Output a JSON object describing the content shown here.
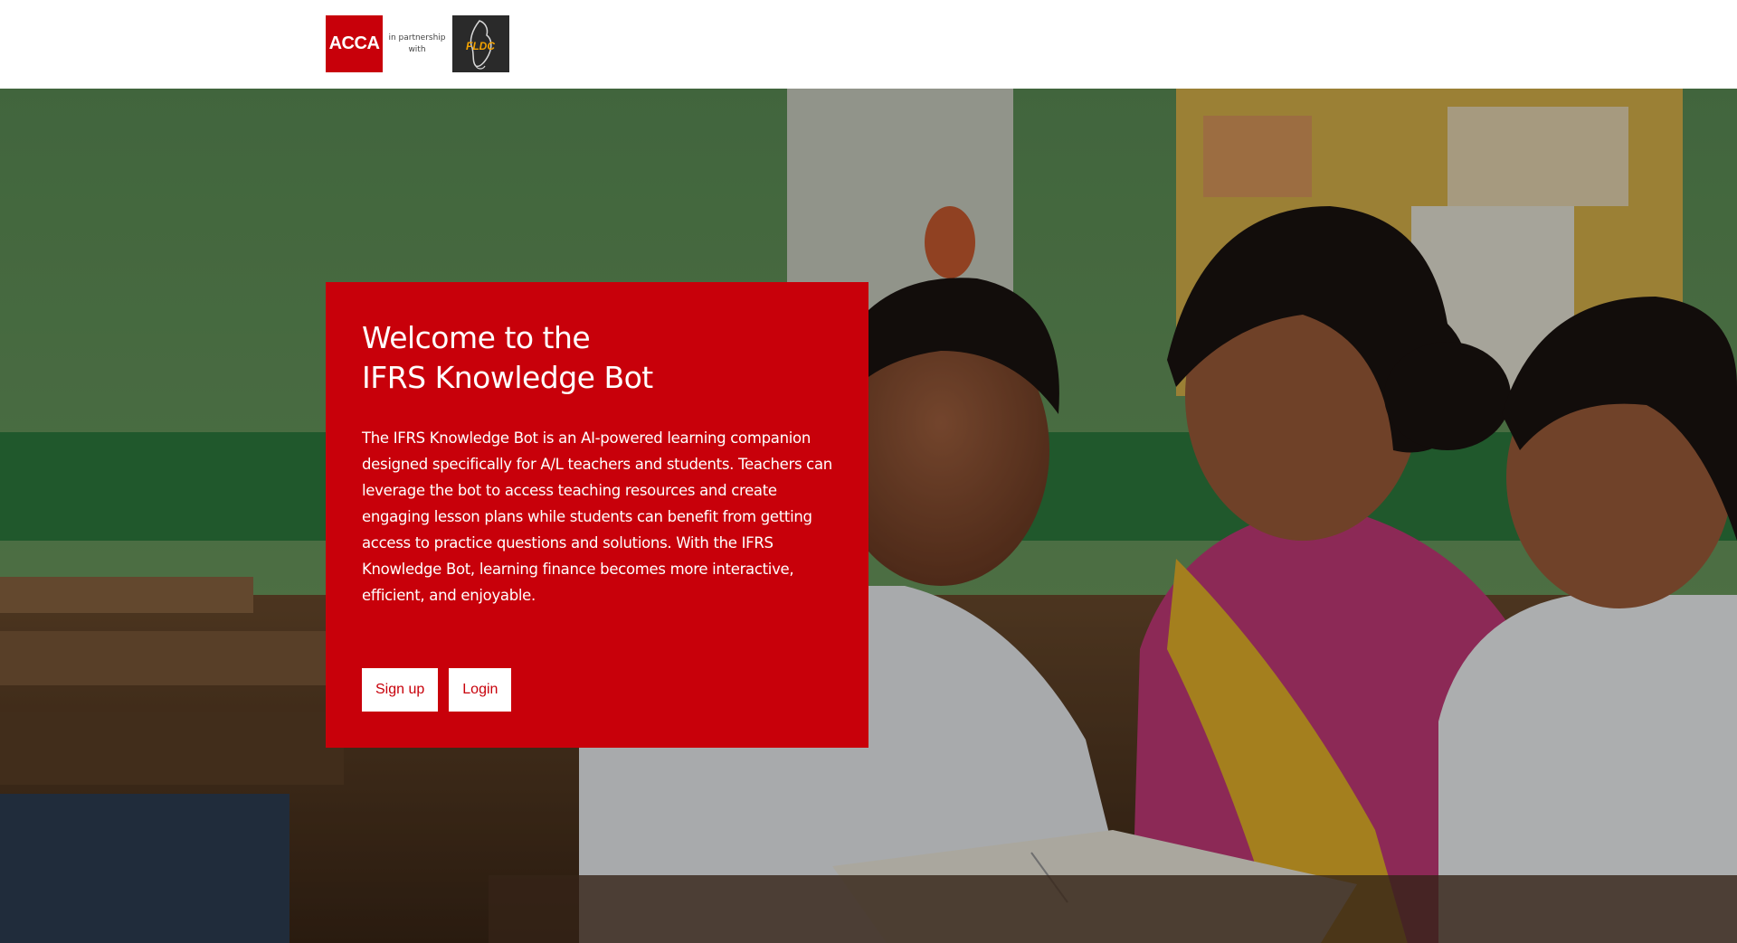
{
  "header": {
    "acca_logo_text": "ACCA",
    "partnership_line1": "in partnership",
    "partnership_line2": "with",
    "partner_logo_text": "FLDC"
  },
  "hero": {
    "title_line1": "Welcome to the",
    "title_line2": "IFRS Knowledge Bot",
    "description": "The IFRS Knowledge Bot is an AI-powered learning companion designed specifically for A/L teachers and students. Teachers can leverage the bot to access teaching resources and create engaging lesson plans while students can benefit from getting access to practice questions and solutions. With the IFRS Knowledge Bot, learning finance becomes more interactive, efficient, and enjoyable.",
    "signup_label": "Sign up",
    "login_label": "Login"
  },
  "colors": {
    "brand_red": "#c8000a",
    "white": "#ffffff"
  }
}
